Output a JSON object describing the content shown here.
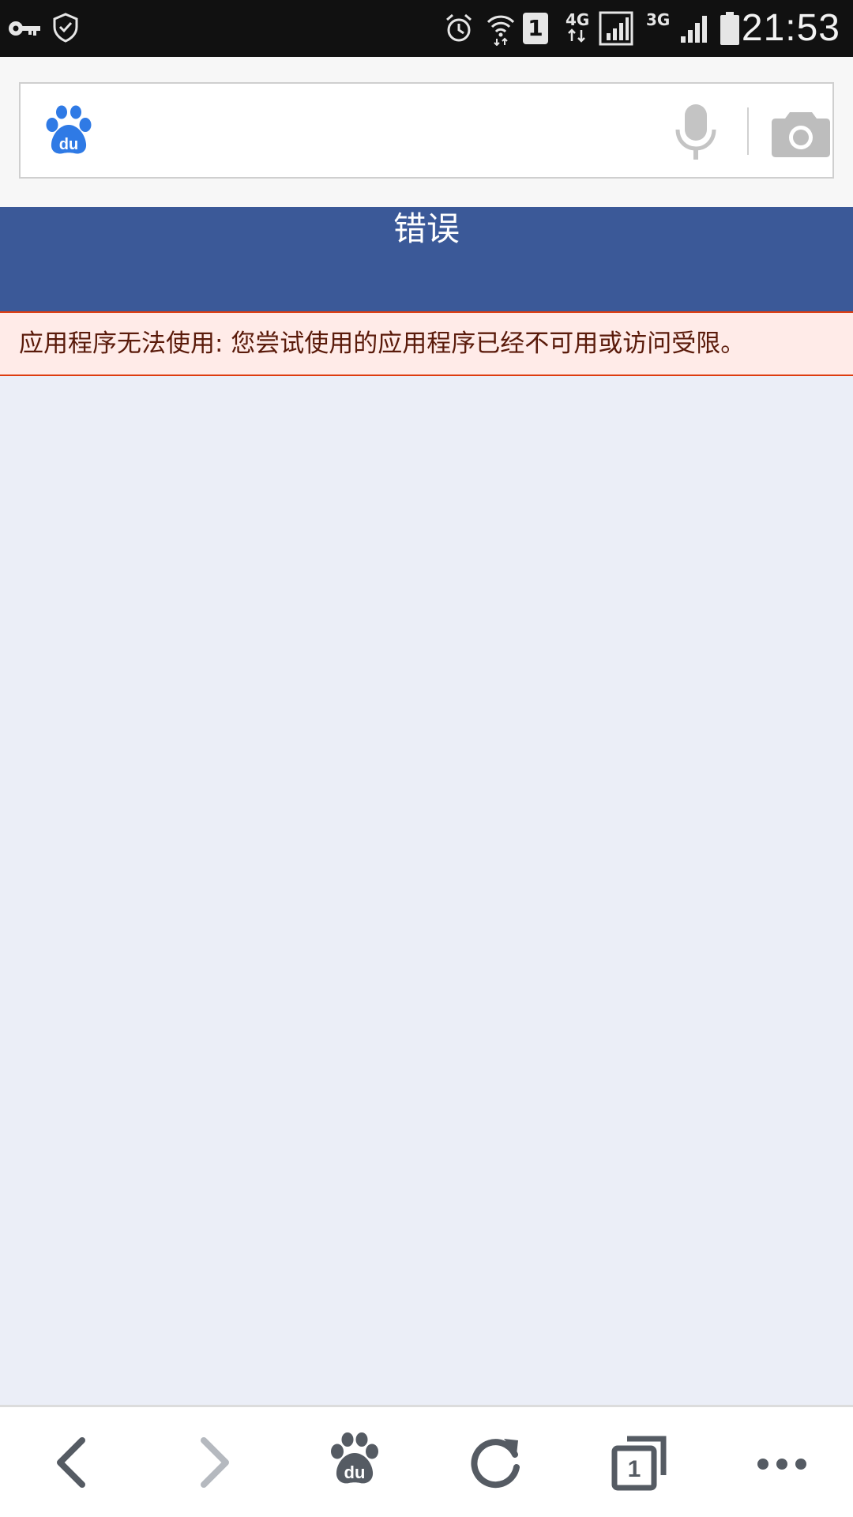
{
  "status_bar": {
    "time": "21:53",
    "sim_slot": "1",
    "network_4g": "4G",
    "network_3g": "3G",
    "icons": [
      "vpn-key-icon",
      "shield-icon",
      "alarm-icon",
      "wifi-icon",
      "sim-1-icon",
      "signal-icon",
      "battery-icon"
    ]
  },
  "search": {
    "value": "",
    "logo": "du",
    "icons": [
      "baidu-paw-icon",
      "microphone-icon",
      "camera-icon"
    ]
  },
  "page": {
    "title": "错误",
    "error_message": "应用程序无法使用: 您尝试使用的应用程序已经不可用或访问受限。"
  },
  "toolbar": {
    "home_logo": "du",
    "tab_count": "1",
    "icons": [
      "back-icon",
      "forward-icon",
      "baidu-home-icon",
      "refresh-icon",
      "tabs-icon",
      "more-icon"
    ]
  },
  "colors": {
    "title_bar": "#3b5998",
    "error_bg": "#ffebe8",
    "error_border": "#dd3c10",
    "page_bg": "#ebeef7",
    "baidu_blue": "#2f7ae5"
  }
}
